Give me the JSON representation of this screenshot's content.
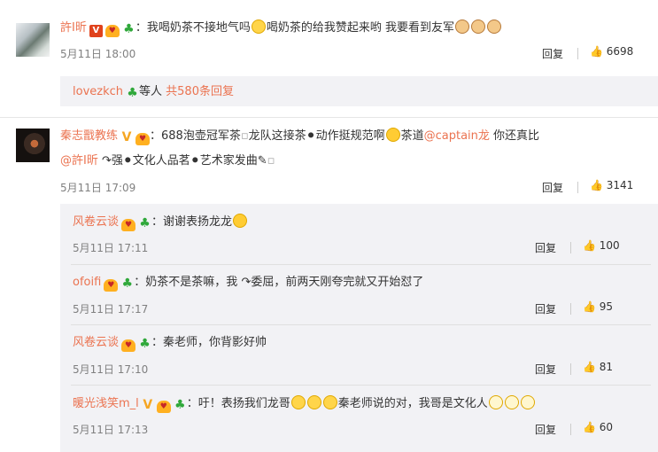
{
  "comments": [
    {
      "user": "許Ⅰ昕",
      "text_a": "：我喝奶茶不接地气吗",
      "text_b": "喝奶茶的给我赞起来哟 我要看到友军",
      "time": "5月11日 18:00",
      "reply_label": "回复",
      "likes": "6698",
      "summary_user": "lovezkch",
      "summary_text": "等人",
      "summary_link": "共580条回复"
    },
    {
      "user": "秦志戬教练",
      "text_a": "：688泡壶冠军茶",
      "text_b": "龙队这接茶",
      "text_c": "动作挺规范啊",
      "text_d": "茶道",
      "mention1": "@captain龙",
      "text_e": " 你还真比",
      "mention2": "@許Ⅰ昕",
      "text_f": "强",
      "text_g": "文化人品茗",
      "text_h": "艺术家发曲",
      "time": "5月11日 17:09",
      "reply_label": "回复",
      "likes": "3141"
    }
  ],
  "replies": [
    {
      "user": "风卷云谈",
      "text": "：谢谢表扬龙龙",
      "time": "5月11日 17:11",
      "reply_label": "回复",
      "likes": "100"
    },
    {
      "user": "ofoifi",
      "text": "：奶茶不是茶嘛，我",
      "text2": "委屈，前两天刚夸完就又开始怼了",
      "time": "5月11日 17:17",
      "reply_label": "回复",
      "likes": "95"
    },
    {
      "user": "风卷云谈",
      "text": "：秦老师，你背影好帅",
      "time": "5月11日 17:10",
      "reply_label": "回复",
      "likes": "81"
    },
    {
      "user": "暖光浅笑m_l",
      "text": "：吁！表扬我们龙哥",
      "text2": "秦老师说的对，我哥是文化人",
      "time": "5月11日 17:13",
      "reply_label": "回复",
      "likes": "60"
    }
  ],
  "colors": {
    "accent": "#eb7350",
    "muted": "#808080",
    "panel": "#f2f2f5"
  },
  "icons": [
    "like-icon",
    "vip-badge-icon",
    "verified-v-icon",
    "fan-badge-icon",
    "green-badge-icon",
    "emoji-icon"
  ]
}
